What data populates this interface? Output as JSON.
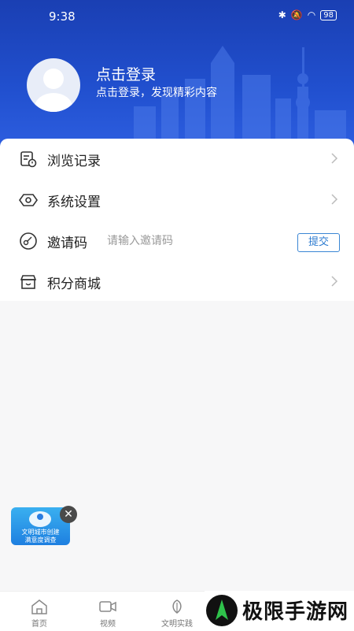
{
  "status_bar": {
    "time": "9:38",
    "battery": "98"
  },
  "profile": {
    "title": "点击登录",
    "subtitle": "点击登录，发现精彩内容"
  },
  "menu": {
    "history_label": "浏览记录",
    "settings_label": "系统设置",
    "invite_label": "邀请码",
    "invite_placeholder": "请输入邀请码",
    "submit_label": "提交",
    "points_label": "积分商城"
  },
  "float_card": {
    "line1": "文明城市创建",
    "line2": "满意度调查"
  },
  "tabs": [
    {
      "label": "首页"
    },
    {
      "label": "视频"
    },
    {
      "label": "文明实践"
    }
  ],
  "watermark": {
    "text": "极限手游网"
  },
  "colors": {
    "header": "#2150cf",
    "accent": "#2c7bd0"
  }
}
